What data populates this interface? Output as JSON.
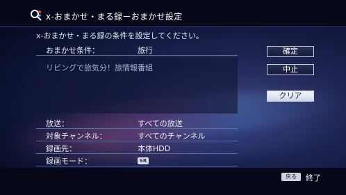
{
  "header": {
    "title": "x-おまかせ・まる録ーおまかせ設定"
  },
  "description": "x-おまかせ・まる録の条件を設定してください。",
  "condition": {
    "label": "おまかせ条件：",
    "value": "旅行"
  },
  "memo_text": "リビングで旅気分！旅情報番組",
  "buttons": {
    "confirm": "確定",
    "cancel": "中止",
    "clear": "クリア"
  },
  "settings": [
    {
      "label": "放送：",
      "value": "すべての放送"
    },
    {
      "label": "対象チャンネル：",
      "value": "すべてのチャンネル"
    },
    {
      "label": "録画先：",
      "value": "本体HDD"
    },
    {
      "label": "録画モード：",
      "value": "SR"
    }
  ],
  "footer": {
    "back_key": "戻る",
    "back_action": "終了"
  }
}
